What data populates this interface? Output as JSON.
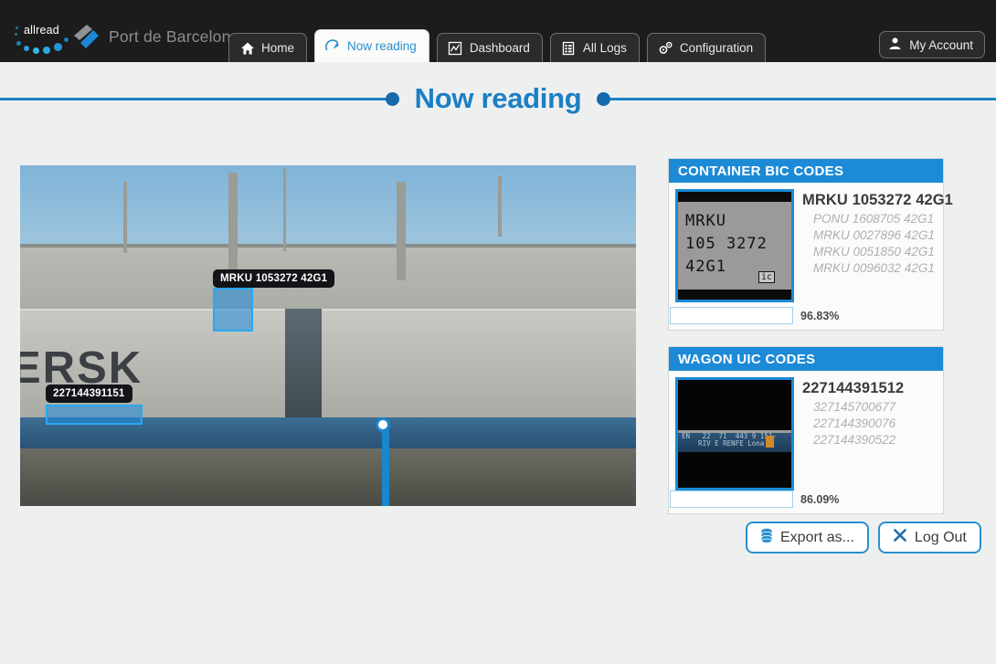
{
  "branding": {
    "allread_name": "allread",
    "client_name": "Port de Barcelona",
    "accent_blue": "#1c8ad6",
    "title_blue": "#1b7fc4",
    "topbar_bg": "#1c1c1c"
  },
  "nav": {
    "tabs": [
      {
        "label": "Home",
        "icon": "home-icon",
        "active": false
      },
      {
        "label": "Now reading",
        "icon": "gauge-icon",
        "active": true
      },
      {
        "label": "Dashboard",
        "icon": "chart-icon",
        "active": false
      },
      {
        "label": "All Logs",
        "icon": "list-icon",
        "active": false
      },
      {
        "label": "Configuration",
        "icon": "gears-icon",
        "active": false
      }
    ],
    "account_label": "My Account",
    "account_icon": "person-icon"
  },
  "page": {
    "title": "Now reading"
  },
  "photo": {
    "detections": [
      {
        "label": "MRKU 1053272 42G1"
      },
      {
        "label": "227144391151"
      }
    ]
  },
  "panels": [
    {
      "heading": "CONTAINER BIC CODES",
      "crop_text_lines": "MRKU\n105 3272\n42G1",
      "crop_badge": "ic",
      "primary_code": "MRKU 1053272 42G1",
      "alternates": [
        "PONU 1608705 42G1",
        "MRKU 0027896 42G1",
        "MRKU 0051850 42G1",
        "MRKU 0096032 42G1"
      ],
      "confidence_label": "96.83%",
      "confidence_percent": 96.83
    },
    {
      "heading": "WAGON UIC CODES",
      "crop_text_lines": "22  71  443 9 151-\nRIV E RENFE Lona",
      "primary_code": "227144391512",
      "alternates": [
        "327145700677",
        "227144390076",
        "227144390522"
      ],
      "confidence_label": "86.09%",
      "confidence_percent": 86.09
    }
  ],
  "actions": {
    "export_label": "Export as...",
    "export_icon": "database-icon",
    "logout_label": "Log Out",
    "logout_icon": "close-x-icon"
  }
}
